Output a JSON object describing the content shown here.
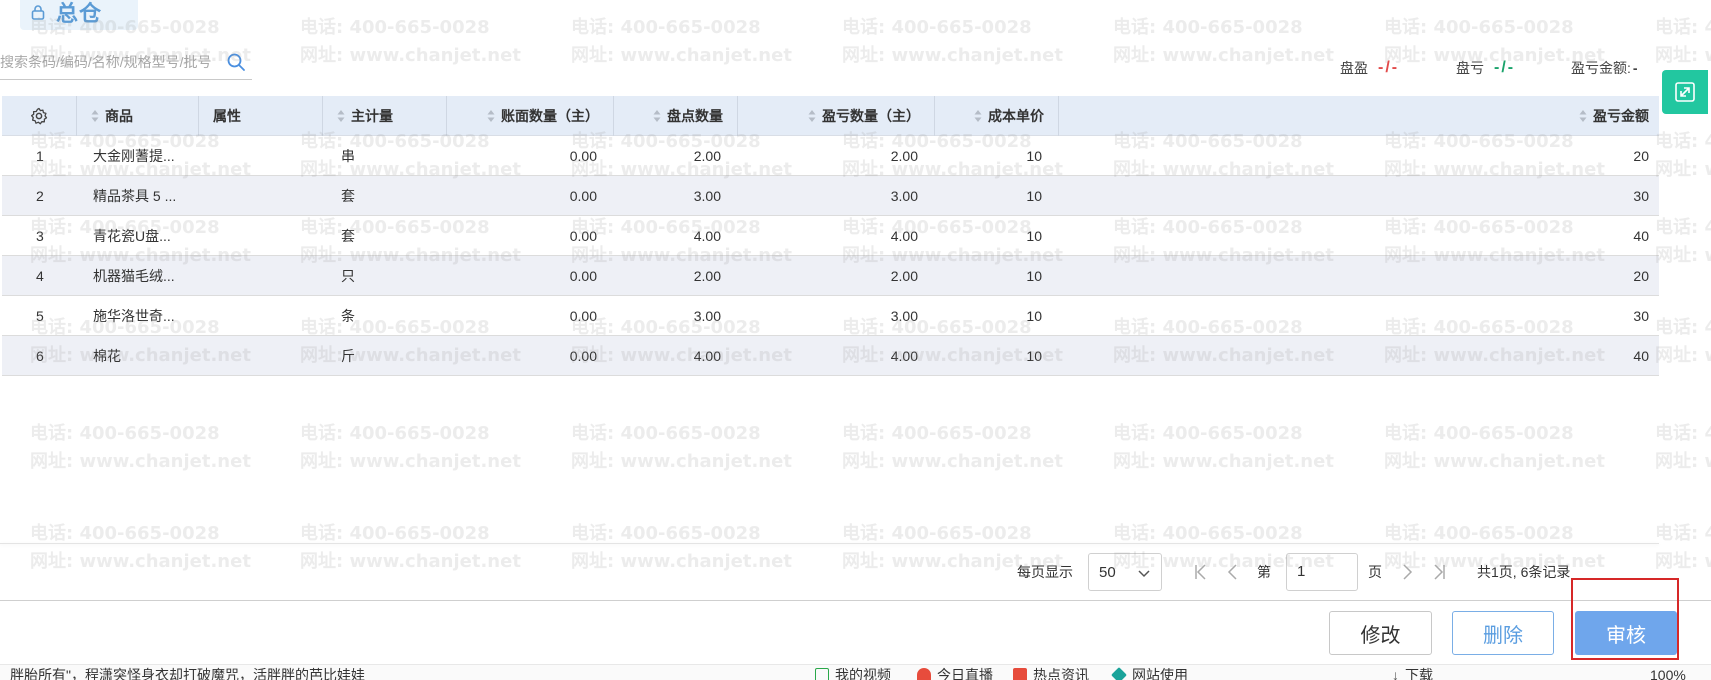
{
  "warehouse": {
    "name": "总仓"
  },
  "search": {
    "placeholder": "搜索条码/编码/名称/规格型号/批号"
  },
  "summary": {
    "surplus_label": "盘盈",
    "surplus_value": "-/-",
    "loss_label": "盘亏",
    "loss_value": "-/-",
    "amount_label": "盈亏金额:",
    "amount_value": "-"
  },
  "table": {
    "columns": [
      {
        "key": "settings",
        "label": ""
      },
      {
        "key": "product",
        "label": "商品"
      },
      {
        "key": "attr",
        "label": "属性"
      },
      {
        "key": "unit",
        "label": "主计量"
      },
      {
        "key": "book_qty",
        "label": "账面数量（主）"
      },
      {
        "key": "count_qty",
        "label": "盘点数量"
      },
      {
        "key": "diff_qty",
        "label": "盈亏数量（主）"
      },
      {
        "key": "unit_cost",
        "label": "成本单价"
      },
      {
        "key": "diff_amount",
        "label": "盈亏金额"
      }
    ],
    "rows": [
      {
        "no": "1",
        "product": "大金刚蓍提...",
        "unit": "串",
        "book_qty": "0.00",
        "count_qty": "2.00",
        "diff_qty": "2.00",
        "unit_cost": "10",
        "diff_amount": "20"
      },
      {
        "no": "2",
        "product": "精品茶具 5 ...",
        "unit": "套",
        "book_qty": "0.00",
        "count_qty": "3.00",
        "diff_qty": "3.00",
        "unit_cost": "10",
        "diff_amount": "30"
      },
      {
        "no": "3",
        "product": "青花瓷U盘...",
        "unit": "套",
        "book_qty": "0.00",
        "count_qty": "4.00",
        "diff_qty": "4.00",
        "unit_cost": "10",
        "diff_amount": "40"
      },
      {
        "no": "4",
        "product": "机器猫毛绒...",
        "unit": "只",
        "book_qty": "0.00",
        "count_qty": "2.00",
        "diff_qty": "2.00",
        "unit_cost": "10",
        "diff_amount": "20"
      },
      {
        "no": "5",
        "product": "施华洛世奇...",
        "unit": "条",
        "book_qty": "0.00",
        "count_qty": "3.00",
        "diff_qty": "3.00",
        "unit_cost": "10",
        "diff_amount": "30"
      },
      {
        "no": "6",
        "product": "棉花",
        "unit": "斤",
        "book_qty": "0.00",
        "count_qty": "4.00",
        "diff_qty": "4.00",
        "unit_cost": "10",
        "diff_amount": "40"
      }
    ]
  },
  "pagination": {
    "per_page_label": "每页显示",
    "per_page_value": "50",
    "page_prefix": "第",
    "page_value": "1",
    "page_suffix": "页",
    "total_text": "共1页, 6条记录"
  },
  "actions": {
    "edit": "修改",
    "delete": "删除",
    "audit": "审核"
  },
  "watermark": {
    "phone": "电话: 400-665-0028",
    "site": "网址: www.chanjet.net"
  },
  "taskbar": {
    "left_text": "胖胎所有\"，程潇突怪身衣却打破魔咒，活胖胖的芭比娃娃",
    "items": [
      "我的视频",
      "今日直播",
      "热点资讯",
      "网站使用",
      "下载",
      "100%"
    ]
  },
  "colors": {
    "accent": "#6fa6ec",
    "header_bg": "#e4ecf7",
    "expand": "#22c7a0",
    "highlight": "#d62828"
  }
}
